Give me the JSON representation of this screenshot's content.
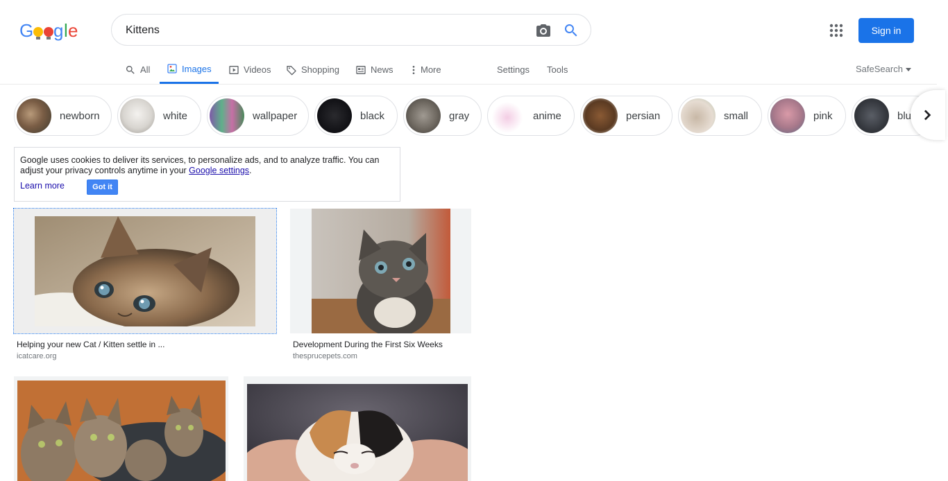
{
  "search": {
    "query": "Kittens"
  },
  "header": {
    "sign_in": "Sign in"
  },
  "tabs": [
    {
      "label": "All",
      "icon": "search-icon"
    },
    {
      "label": "Images",
      "icon": "image-icon",
      "active": true
    },
    {
      "label": "Videos",
      "icon": "video-icon"
    },
    {
      "label": "Shopping",
      "icon": "tag-icon"
    },
    {
      "label": "News",
      "icon": "newspaper-icon"
    },
    {
      "label": "More",
      "icon": "more-vert-icon"
    }
  ],
  "tools": {
    "settings": "Settings",
    "tools": "Tools",
    "safesearch": "SafeSearch"
  },
  "chips": [
    {
      "label": "newborn"
    },
    {
      "label": "white"
    },
    {
      "label": "wallpaper"
    },
    {
      "label": "black"
    },
    {
      "label": "gray"
    },
    {
      "label": "anime"
    },
    {
      "label": "persian"
    },
    {
      "label": "small"
    },
    {
      "label": "pink"
    },
    {
      "label": "blue"
    }
  ],
  "cookie": {
    "text": "Google uses cookies to deliver its services, to personalize ads, and to analyze traffic. You can adjust your privacy controls anytime in your",
    "link": "Google settings",
    "tail": ".",
    "learn_more": "Learn more",
    "got_it": "Got it"
  },
  "results": [
    {
      "title": "Helping your new Cat / Kitten settle in ...",
      "source": "icatcare.org"
    },
    {
      "title": "Development During the First Six Weeks",
      "source": "thesprucepets.com"
    },
    {
      "title": "",
      "source": ""
    },
    {
      "title": "",
      "source": ""
    }
  ],
  "colors": {
    "accent": "#1a73e8",
    "got_it": "#4285f4",
    "link": "#1a0dab"
  }
}
